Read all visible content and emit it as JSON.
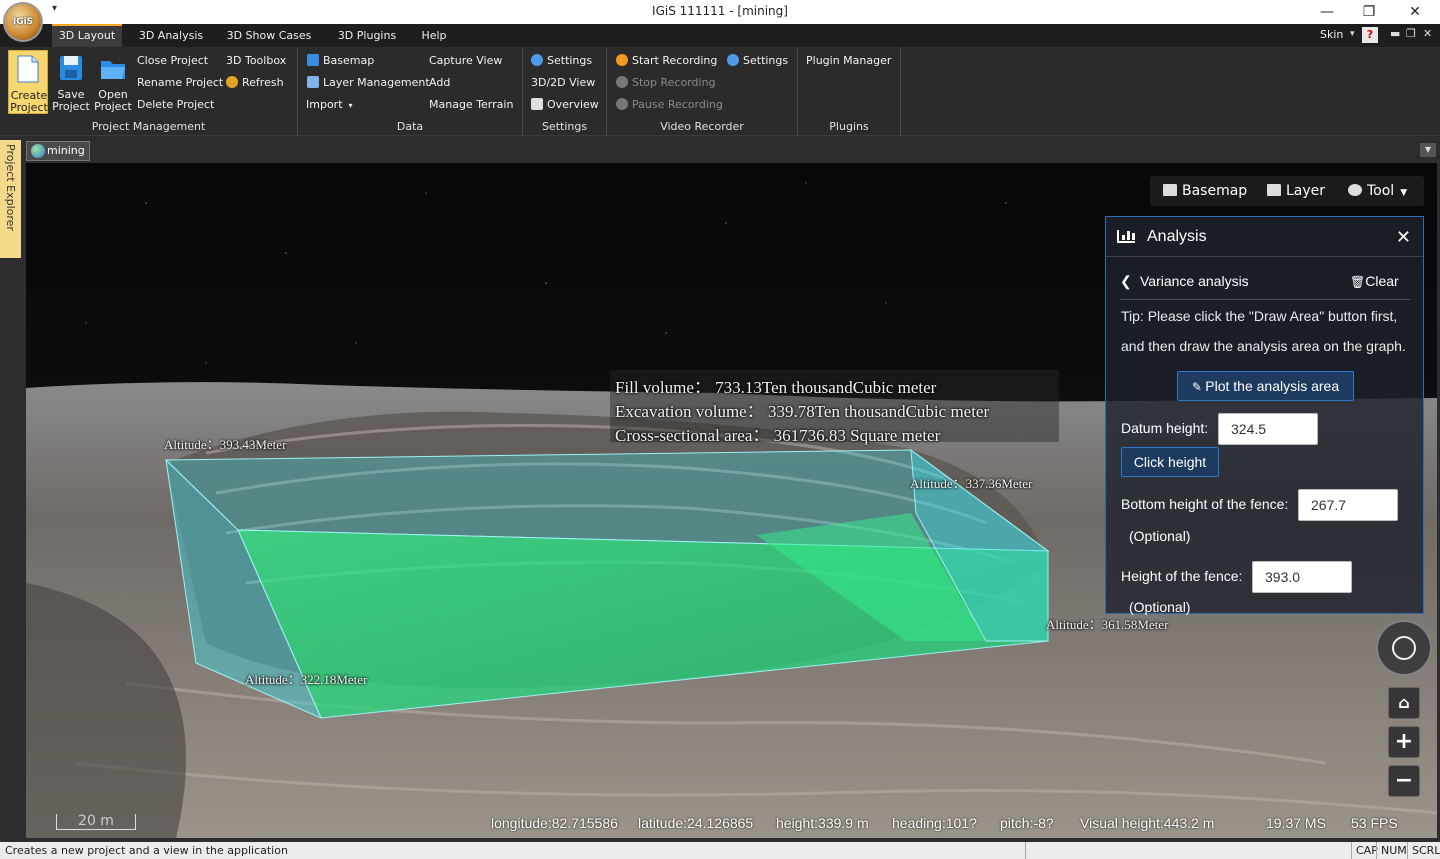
{
  "window": {
    "title": "IGiS 111111 - [mining]",
    "logo_text": "IGiS",
    "minimize": "—",
    "restore": "❐",
    "close": "✕"
  },
  "menu": {
    "tabs": [
      "3D Layout",
      "3D Analysis",
      "3D Show Cases",
      "3D Plugins",
      "Help"
    ],
    "active_tab": "3D Layout",
    "skin": "Skin",
    "skin_arrow": "▾",
    "help": "?"
  },
  "ribbon": {
    "project_management": {
      "label": "Project Management",
      "create": "Create Project",
      "save": "Save Project",
      "open": "Open Project",
      "close_project": "Close Project",
      "rename_project": "Rename Project",
      "delete_project": "Delete Project",
      "toolbox": "3D Toolbox",
      "refresh": "Refresh"
    },
    "data": {
      "label": "Data",
      "basemap": "Basemap",
      "layer_management": "Layer Management",
      "import": "Import",
      "capture_view": "Capture View",
      "add": "Add",
      "manage_terrain": "Manage Terrain"
    },
    "settings": {
      "label": "Settings",
      "settings": "Settings",
      "view_2d3d": "3D/2D View",
      "overview": "Overview"
    },
    "video": {
      "label": "Video Recorder",
      "start": "Start Recording",
      "stop": "Stop Recording",
      "pause": "Pause Recording",
      "settings": "Settings"
    },
    "plugins": {
      "label": "Plugins",
      "manager": "Plugin Manager"
    }
  },
  "side_panel": "Project Explorer",
  "doc_tab": "mining",
  "toolbar": {
    "basemap": "Basemap",
    "layer": "Layer",
    "tool": "Tool"
  },
  "analysis": {
    "title": "Analysis",
    "sub_title": "Variance analysis",
    "clear": "Clear",
    "tip_line1": "Tip: Please click the \"Draw Area\" button first,",
    "tip_line2": "and then draw the analysis area on the graph.",
    "plot_button": "Plot the analysis area",
    "datum_label": "Datum height:",
    "datum_value": "324.5",
    "click_height": "Click height",
    "bottom_label": "Bottom height of the fence:",
    "bottom_value": "267.7",
    "optional": "(Optional)",
    "fence_label": "Height of the fence:",
    "fence_value": "393.0"
  },
  "scene": {
    "fill_volume": "Fill volume：  733.13Ten thousandCubic meter",
    "excavation_volume": "Excavation volume：  339.78Ten thousandCubic meter",
    "cross_section": "Cross-sectional area：  361736.83 Square meter",
    "alt_top_left": "Altitude：393.43Meter",
    "alt_top_right": "Altitude：337.36Meter",
    "alt_bottom_right": "Altitude：361.58Meter",
    "alt_bottom_left": "Altitude：322.18Meter"
  },
  "status": {
    "scale": "20 m",
    "longitude": "longitude:82.715586",
    "latitude": "latitude:24.126865",
    "height": "height:339.9 m",
    "heading": "heading:101?",
    "pitch": "pitch:-8?",
    "visual_height": "Visual height:443.2 m",
    "ms": "19.37 MS",
    "fps": "53 FPS"
  },
  "app_status": {
    "message": "Creates a new project and a view in the application",
    "cap": "CAP",
    "num": "NUM",
    "scrl": "SCRL"
  },
  "nav": {
    "zoom_in": "+",
    "zoom_out": "−"
  },
  "colors": {
    "accent": "#f5a623",
    "panel_border": "#2f6db3",
    "fill_green": "#2ee68a",
    "fence_cyan": "#3fd6e0"
  }
}
